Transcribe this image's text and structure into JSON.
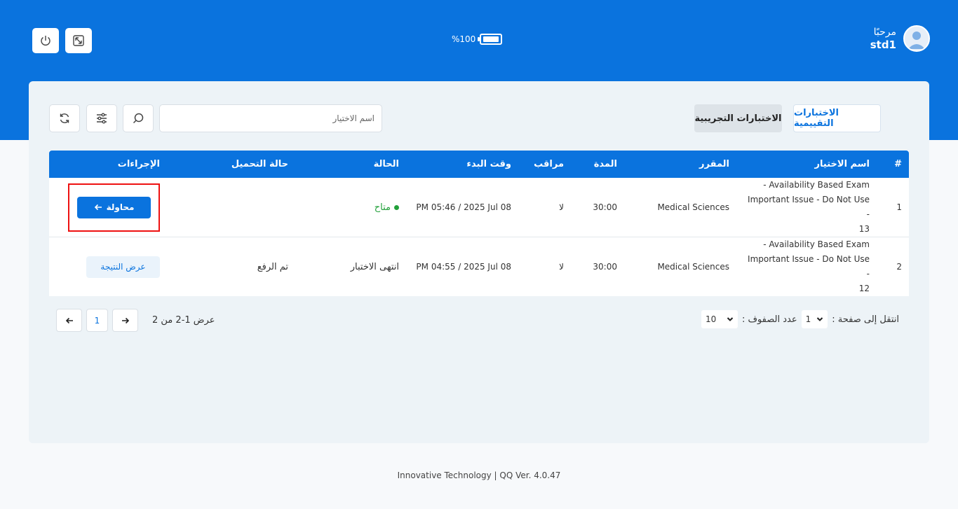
{
  "header": {
    "greeting": "مرحبًا",
    "username": "std1",
    "battery": "%100"
  },
  "tabs": {
    "assessment": "الاختبارات التقييمية",
    "practice": "الاختبارات التجريبية"
  },
  "search": {
    "placeholder": "اسم الاختيار"
  },
  "table": {
    "headers": {
      "num": "#",
      "name": "اسم الاختيار",
      "course": "المقرر",
      "duration": "المدة",
      "proctor": "مراقب",
      "start": "وقت البدء",
      "status": "الحالة",
      "upload": "حالة التحميل",
      "actions": "الإجراءات"
    },
    "rows": [
      {
        "num": "1",
        "name_line1": "Availability Based Exam -",
        "name_line2": "Important Issue - Do Not Use -",
        "name_line3": "13",
        "course": "Medical Sciences",
        "duration": "30:00",
        "proctor": "لا",
        "start": "PM 05:46 / 2025 Jul 08",
        "status": "متاح",
        "upload": "",
        "action": "محاولة"
      },
      {
        "num": "2",
        "name_line1": "Availability Based Exam -",
        "name_line2": "Important Issue - Do Not Use -",
        "name_line3": "12",
        "course": "Medical Sciences",
        "duration": "30:00",
        "proctor": "لا",
        "start": "PM 04:55 / 2025 Jul 08",
        "status": "انتهى الاختبار",
        "upload": "تم الرفع",
        "action": "عرض النتيجة"
      }
    ]
  },
  "pagination": {
    "goto_label": "انتقل إلى صفحة :",
    "goto_value": "1",
    "rows_label": "عدد الصفوف :",
    "rows_value": "10",
    "info": "عرض 1-2 من 2",
    "current_page": "1"
  },
  "footer": "Innovative Technology | QQ Ver. 4.0.47",
  "colors": {
    "primary": "#0a73de",
    "available": "#22a03a",
    "highlight": "#e11111"
  }
}
